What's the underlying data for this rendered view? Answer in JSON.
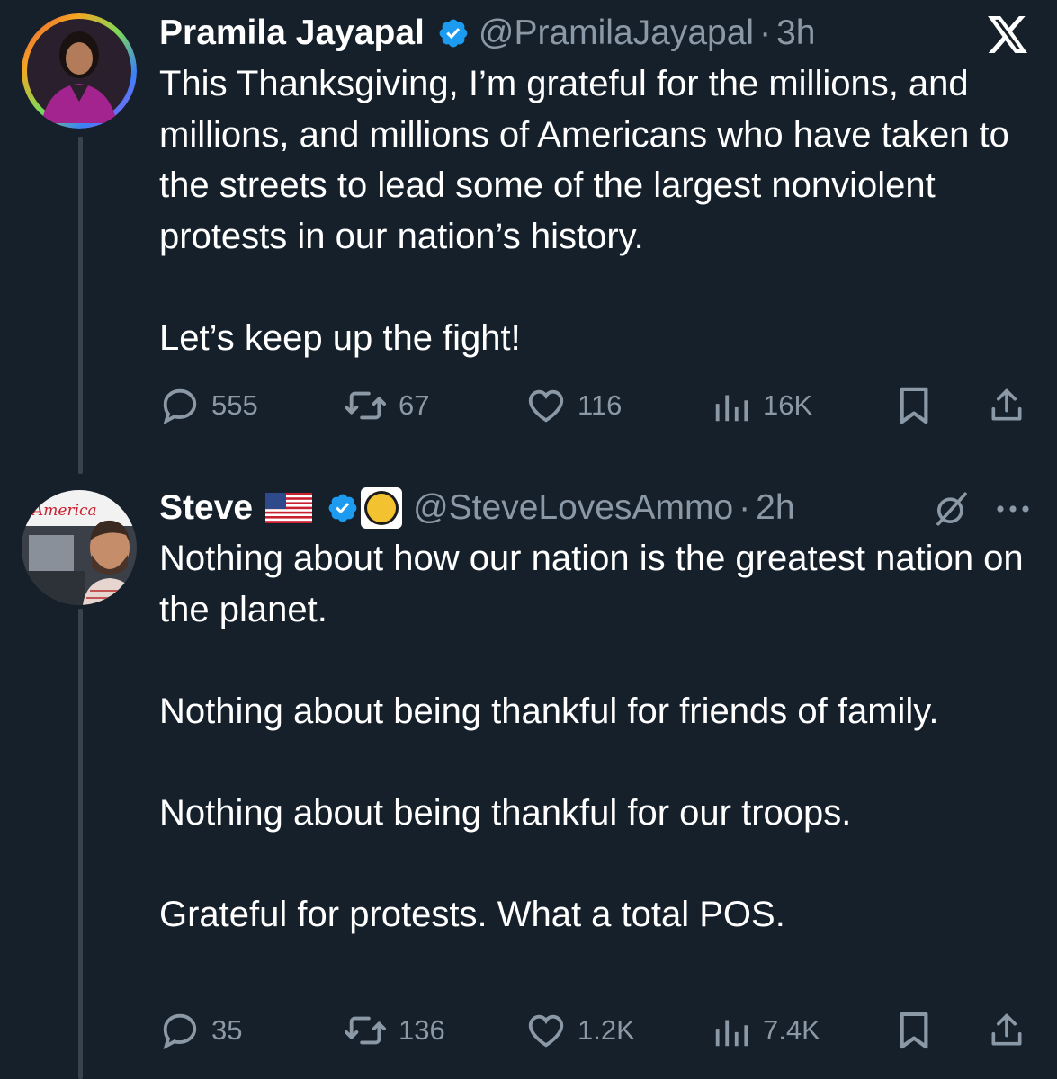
{
  "colors": {
    "background": "#15202b",
    "text_primary": "#ffffff",
    "text_secondary": "#8b98a5",
    "verified_blue": "#1d9bf0",
    "thread_line": "#38444d"
  },
  "tweets": [
    {
      "author_name": "Pramila Jayapal",
      "handle": "@PramilaJayapal",
      "separator": "·",
      "time": "3h",
      "verified": true,
      "top_right_icon": "x-logo-icon",
      "paragraphs": [
        "This Thanksgiving, I’m grateful for the millions, and millions, and millions of Americans who have taken to the streets to lead some of the largest nonviolent protests in our nation’s history.",
        "Let’s keep up the fight!"
      ],
      "stats": {
        "replies": "555",
        "reposts": "67",
        "likes": "116",
        "views": "16K"
      }
    },
    {
      "author_name": "Steve",
      "name_emoji": "us-flag-icon",
      "handle": "@SteveLovesAmmo",
      "separator": "·",
      "time": "2h",
      "verified": true,
      "affiliate_badge": "gold-circle-badge-icon",
      "top_right_icon": "grok-icon",
      "more_icon": "more-options-icon",
      "paragraphs": [
        "Nothing about how our nation is the greatest nation on the planet.",
        "Nothing about being thankful for friends of family.",
        "Nothing about being thankful for our troops.",
        "Grateful for protests. What a total POS."
      ],
      "stats": {
        "replies": "35",
        "reposts": "136",
        "likes": "1.2K",
        "views": "7.4K"
      }
    }
  ]
}
